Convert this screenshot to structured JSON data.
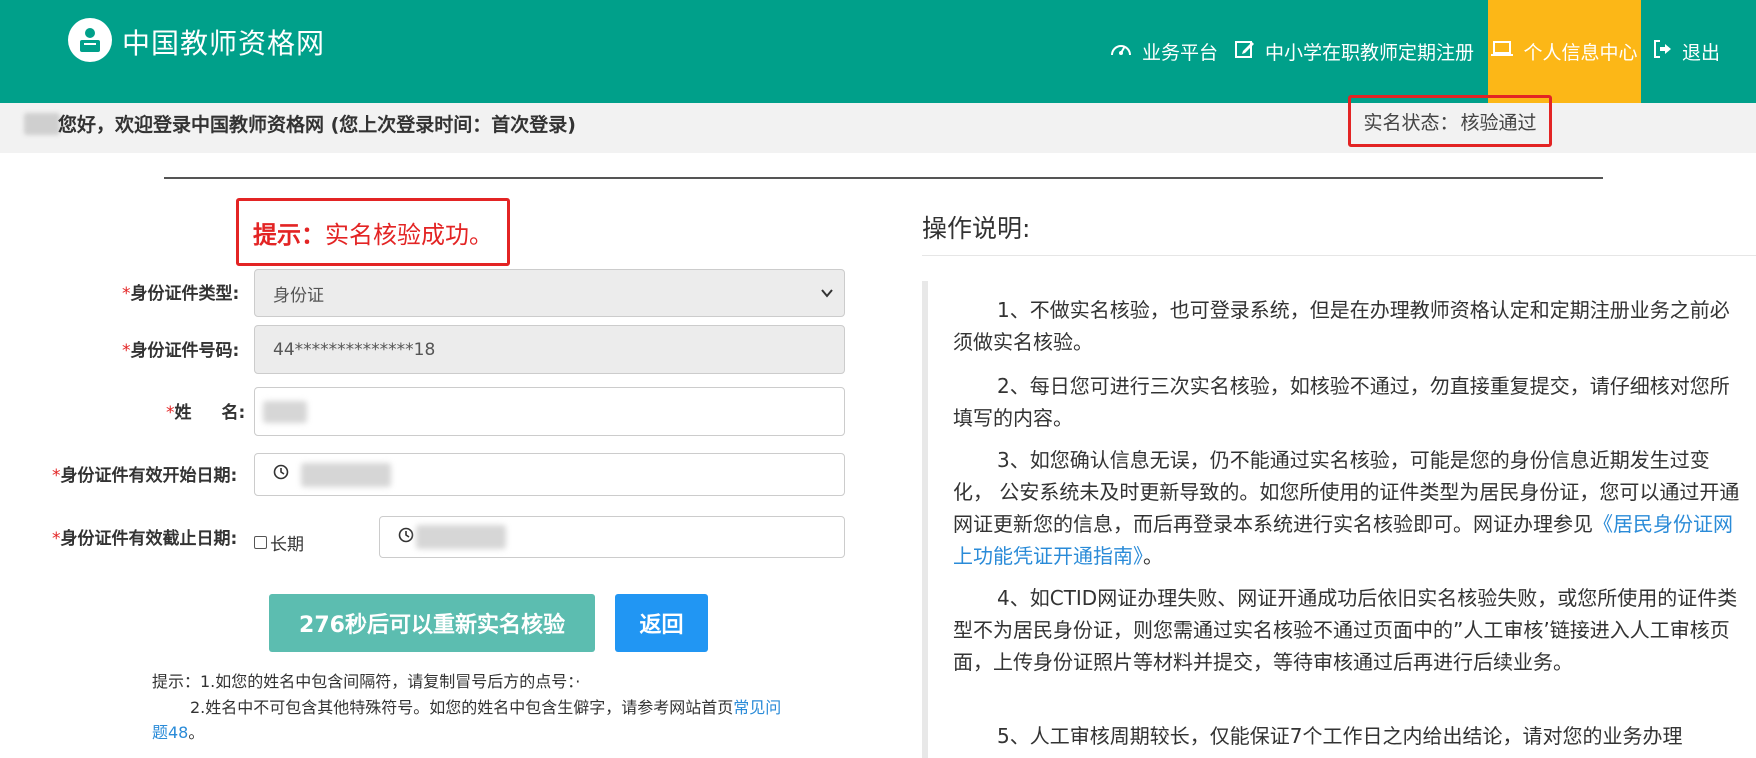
{
  "header": {
    "site_title": "中国教师资格网",
    "nav": {
      "business_platform": "业务平台",
      "periodic_registration": "中小学在职教师定期注册",
      "personal_center": "个人信息中心",
      "logout": "退出"
    }
  },
  "welcome": {
    "text": "您好，欢迎登录中国教师资格网 (您上次登录时间：首次登录)",
    "status_label": "实名状态：",
    "status_value": "核验通过"
  },
  "tip": {
    "label": "提示：",
    "message": "实名核验成功。"
  },
  "form": {
    "id_type_label": "身份证件类型:",
    "id_type_value": "身份证",
    "id_number_label": "身份证件号码:",
    "id_number_value": "44**************18",
    "name_label_1": "姓",
    "name_label_2": "名:",
    "valid_start_label": "身份证件有效开始日期:",
    "valid_end_label": "身份证件有效截止日期:",
    "long_term_label": "长期",
    "required_mark": "*"
  },
  "buttons": {
    "retry": "276秒后可以重新实名核验",
    "back": "返回"
  },
  "hints": {
    "line1": "提示：1.如您的姓名中包含间隔符，请复制冒号后方的点号：·",
    "line2_text": "2.姓名中不可包含其他特殊符号。如您的姓名中包含生僻字，请参考网站首页",
    "line2_link_a": "常见问",
    "line2_link_b": "题48",
    "line2_end": "。"
  },
  "instructions": {
    "title": "操作说明:",
    "p1": "1、不做实名核验，也可登录系统，但是在办理教师资格认定和定期注册业务之前必须做实名核验。",
    "p2": "2、每日您可进行三次实名核验，如核验不通过，勿直接重复提交，请仔细核对您所填写的内容。",
    "p3_text": "3、如您确认信息无误，仍不能通过实名核验，可能是您的身份信息近期发生过变化， 公安系统未及时更新导致的。如您所使用的证件类型为居民身份证，您可以通过开通网证更新您的信息，而后再登录本系统进行实名核验即可。网证办理参见",
    "p3_link": "《居民身份证网上功能凭证开通指南》",
    "p3_end": "。",
    "p4": "4、如CTID网证办理失败、网证开通成功后依旧实名核验失败，或您所使用的证件类型不为居民身份证，则您需通过实名核验不通过页面中的”人工审核’链接进入人工审核页面，上传身份证照片等材料并提交，等待审核通过后再进行后续业务。",
    "p5": "5、人工审核周期较长，仅能保证7个工作日之内给出结论，请对您的业务办理"
  },
  "colors": {
    "header_bg": "#00a08a",
    "active_nav_bg": "#fcb717",
    "highlight_border": "#e32424",
    "retry_button": "#5cbdb0",
    "back_button": "#2196f3",
    "link": "#2a8bd8"
  },
  "icons": {
    "logo": "teacher-logo-icon",
    "business_platform": "dashboard-gauge-icon",
    "periodic_registration": "edit-icon",
    "personal_center": "laptop-icon",
    "logout": "sign-out-icon",
    "date": "clock-icon",
    "select": "chevron-down-icon"
  }
}
